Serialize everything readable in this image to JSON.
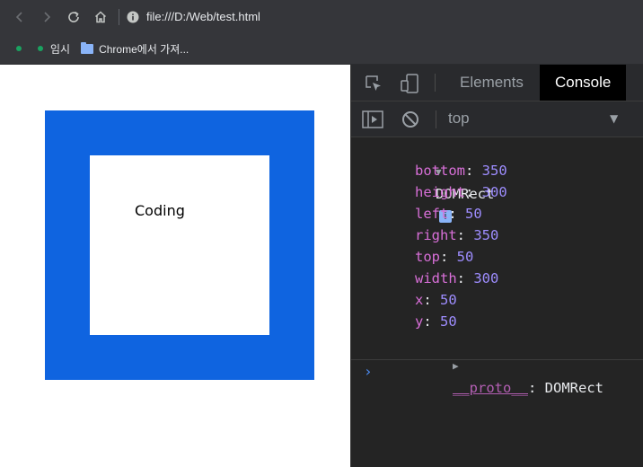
{
  "browser": {
    "url": "file:///D:/Web/test.html",
    "bookmarks": [
      {
        "label": "임시"
      },
      {
        "label": "Chrome에서 가져..."
      }
    ]
  },
  "page": {
    "text": "Coding",
    "colors": {
      "outer_box": "#0f64e0",
      "inner_box": "#ffffff"
    }
  },
  "devtools": {
    "tabs": [
      {
        "label": "Elements",
        "active": false
      },
      {
        "label": "Console",
        "active": true
      }
    ],
    "context": "top",
    "object": {
      "name": "DOMRect",
      "info": "i",
      "properties": [
        {
          "key": "bottom",
          "value": "350"
        },
        {
          "key": "height",
          "value": "300"
        },
        {
          "key": "left",
          "value": "50"
        },
        {
          "key": "right",
          "value": "350"
        },
        {
          "key": "top",
          "value": "50"
        },
        {
          "key": "width",
          "value": "300"
        },
        {
          "key": "x",
          "value": "50"
        },
        {
          "key": "y",
          "value": "50"
        }
      ],
      "proto_key": "__proto__",
      "proto_value": "DOMRect"
    },
    "prompt": "›"
  }
}
